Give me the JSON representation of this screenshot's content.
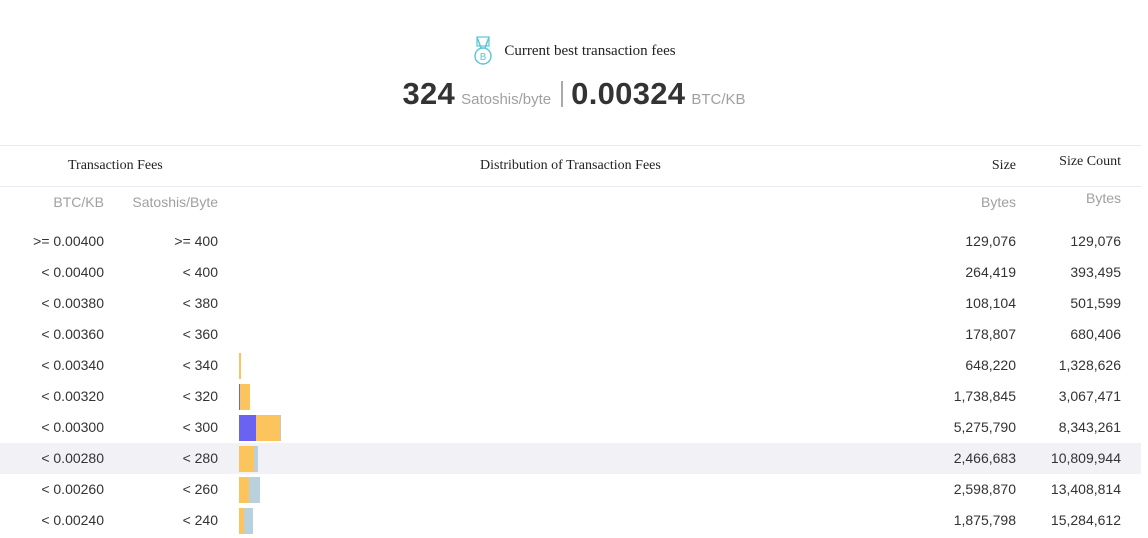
{
  "header": {
    "title": "Current best transaction fees",
    "satoshi_value": "324",
    "satoshi_unit": "Satoshis/byte",
    "btc_value": "0.00324",
    "btc_unit": "BTC/KB",
    "icon": "bitcoin-medal-icon"
  },
  "table": {
    "headers": {
      "fees": "Transaction Fees",
      "distribution": "Distribution of Transaction Fees",
      "size": "Size",
      "size_count": "Size Count"
    },
    "subheaders": {
      "btc": "BTC/KB",
      "sat": "Satoshis/Byte",
      "size": "Bytes",
      "size_count": "Bytes"
    },
    "colors": {
      "blue": "#6a63f2",
      "orange": "#fcc45d",
      "lightblue": "#b9d1dc",
      "gray": "#c8c8c8"
    },
    "rows": [
      {
        "btc": ">= 0.00400",
        "sat": ">= 400",
        "size": "129,076",
        "count": "129,076",
        "highlight": false,
        "segments": []
      },
      {
        "btc": "< 0.00400",
        "sat": "< 400",
        "size": "264,419",
        "count": "393,495",
        "highlight": false,
        "segments": []
      },
      {
        "btc": "< 0.00380",
        "sat": "< 380",
        "size": "108,104",
        "count": "501,599",
        "highlight": false,
        "segments": []
      },
      {
        "btc": "< 0.00360",
        "sat": "< 360",
        "size": "178,807",
        "count": "680,406",
        "highlight": false,
        "segments": []
      },
      {
        "btc": "< 0.00340",
        "sat": "< 340",
        "size": "648,220",
        "count": "1,328,626",
        "highlight": false,
        "segments": [
          {
            "color": "orange",
            "w": 2
          }
        ]
      },
      {
        "btc": "< 0.00320",
        "sat": "< 320",
        "size": "1,738,845",
        "count": "3,067,471",
        "highlight": false,
        "segments": [
          {
            "color": "blue",
            "w": 1
          },
          {
            "color": "orange",
            "w": 10
          }
        ]
      },
      {
        "btc": "< 0.00300",
        "sat": "< 300",
        "size": "5,275,790",
        "count": "8,343,261",
        "highlight": false,
        "segments": [
          {
            "color": "blue",
            "w": 17
          },
          {
            "color": "orange",
            "w": 24
          },
          {
            "color": "gray",
            "w": 1
          }
        ]
      },
      {
        "btc": "< 0.00280",
        "sat": "< 280",
        "size": "2,466,683",
        "count": "10,809,944",
        "highlight": true,
        "segments": [
          {
            "color": "orange",
            "w": 15
          },
          {
            "color": "lightblue",
            "w": 4
          }
        ]
      },
      {
        "btc": "< 0.00260",
        "sat": "< 260",
        "size": "2,598,870",
        "count": "13,408,814",
        "highlight": false,
        "segments": [
          {
            "color": "orange",
            "w": 10
          },
          {
            "color": "lightblue",
            "w": 11
          }
        ]
      },
      {
        "btc": "< 0.00240",
        "sat": "< 240",
        "size": "1,875,798",
        "count": "15,284,612",
        "highlight": false,
        "segments": [
          {
            "color": "orange",
            "w": 5
          },
          {
            "color": "lightblue",
            "w": 9
          }
        ]
      }
    ]
  }
}
